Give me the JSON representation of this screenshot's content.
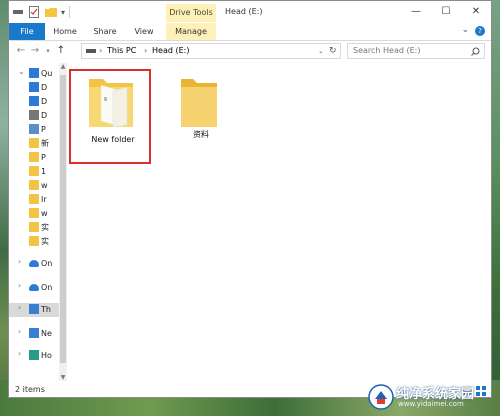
{
  "window": {
    "title": "Head (E:)",
    "context_tab": "Drive Tools"
  },
  "tabs": [
    {
      "label": "File"
    },
    {
      "label": "Home"
    },
    {
      "label": "Share"
    },
    {
      "label": "View"
    },
    {
      "label": "Manage"
    }
  ],
  "address": {
    "crumbs": [
      "This PC",
      "Head (E:)"
    ],
    "search_placeholder": "Search Head (E:)"
  },
  "nav": {
    "items": [
      {
        "label": "Qu",
        "icon": "star-icon"
      },
      {
        "label": "D",
        "icon": "desktop-icon"
      },
      {
        "label": "D",
        "icon": "download-icon"
      },
      {
        "label": "D",
        "icon": "documents-icon"
      },
      {
        "label": "P",
        "icon": "pictures-icon"
      },
      {
        "label": "新",
        "icon": "folder-icon"
      },
      {
        "label": "P",
        "icon": "folder-icon"
      },
      {
        "label": "1",
        "icon": "folder-icon"
      },
      {
        "label": "w",
        "icon": "folder-icon"
      },
      {
        "label": "Ir",
        "icon": "folder-icon"
      },
      {
        "label": "w",
        "icon": "folder-icon"
      },
      {
        "label": "实",
        "icon": "folder-icon"
      },
      {
        "label": "实",
        "icon": "folder-icon"
      },
      {
        "label": "On",
        "icon": "onedrive-icon"
      },
      {
        "label": "On",
        "icon": "onedrive-icon"
      },
      {
        "label": "Th",
        "icon": "this-pc-icon"
      },
      {
        "label": "Ne",
        "icon": "network-icon"
      },
      {
        "label": "Ho",
        "icon": "homegroup-icon"
      }
    ]
  },
  "content": {
    "files": [
      {
        "name": "New folder",
        "selected": true
      },
      {
        "name": "资料",
        "selected": false
      }
    ]
  },
  "status": {
    "item_count": "2 items"
  },
  "watermark": {
    "text": "纯净系统家园",
    "url": "www.yidaimei.com"
  },
  "colors": {
    "accent": "#1979ca",
    "context_tab": "#fdf0b8",
    "folder": "#f5c542",
    "highlight": "#d9302c"
  }
}
